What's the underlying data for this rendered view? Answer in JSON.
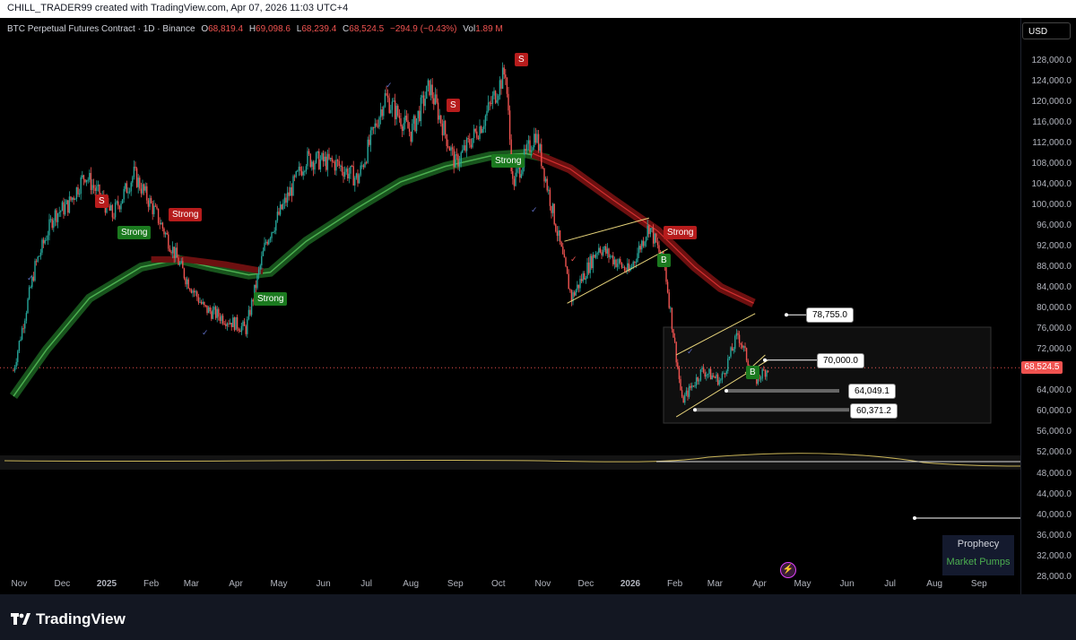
{
  "watermark": "CHILL_TRADER99 created with TradingView.com, Apr 07, 2026 11:03 UTC+4",
  "legend": {
    "symbol": "BTC Perpetual Futures Contract · 1D · Binance",
    "open_label": "O",
    "open": "68,819.4",
    "high_label": "H",
    "high": "69,098.6",
    "low_label": "L",
    "low": "68,239.4",
    "close_label": "C",
    "close": "68,524.5",
    "change": "−294.9 (−0.43%)",
    "vol_label": "Vol",
    "vol": "1.89 M"
  },
  "currency": "USD",
  "current_price": "68,524.5",
  "price_scale": [
    "128,000.0",
    "124,000.0",
    "120,000.0",
    "116,000.0",
    "112,000.0",
    "108,000.0",
    "104,000.0",
    "100,000.0",
    "96,000.0",
    "92,000.0",
    "88,000.0",
    "84,000.0",
    "80,000.0",
    "76,000.0",
    "72,000.0",
    "64,000.0",
    "60,000.0",
    "56,000.0",
    "52,000.0",
    "48,000.0",
    "44,000.0",
    "40,000.0",
    "36,000.0",
    "32,000.0",
    "28,000.0"
  ],
  "time_axis": [
    "Nov",
    "Dec",
    "2025",
    "Feb",
    "Mar",
    "Apr",
    "May",
    "Jun",
    "Jul",
    "Aug",
    "Sep",
    "Oct",
    "Nov",
    "Dec",
    "2026",
    "Feb",
    "Mar",
    "Apr",
    "May",
    "Jun",
    "Jul",
    "Aug",
    "Sep"
  ],
  "callouts": {
    "level_78755": "78,755.0",
    "level_70000": "70,000.0",
    "level_64049": "64,049.1",
    "level_60371": "60,371.2"
  },
  "signals": {
    "strong": "Strong",
    "sell": "S",
    "buy": "B"
  },
  "indicator": {
    "prophecy": "Prophecy",
    "market_pumps": "Market Pumps"
  },
  "footer": {
    "brand": "TradingView"
  },
  "colors": {
    "up": "#26a69a",
    "down": "#ef5350",
    "ribbon_green": "#1b5e20",
    "ribbon_red": "#6d1010",
    "trendline": "#e6d37a",
    "oscillator": "#c9b458"
  },
  "chart_data": {
    "type": "candlestick",
    "x_label": "date",
    "y_label": "USD",
    "ylim": [
      28000,
      130000
    ],
    "path": [
      [
        "2024-10-28",
        68000
      ],
      [
        "2024-11-12",
        88000
      ],
      [
        "2024-11-25",
        98000
      ],
      [
        "2024-12-05",
        100000
      ],
      [
        "2024-12-17",
        106000
      ],
      [
        "2025-01-05",
        98000
      ],
      [
        "2025-01-20",
        106000
      ],
      [
        "2025-02-05",
        98000
      ],
      [
        "2025-02-25",
        86000
      ],
      [
        "2025-03-10",
        80000
      ],
      [
        "2025-04-08",
        76000
      ],
      [
        "2025-04-22",
        93000
      ],
      [
        "2025-05-20",
        109000
      ],
      [
        "2025-06-10",
        108000
      ],
      [
        "2025-06-25",
        105000
      ],
      [
        "2025-07-14",
        121000
      ],
      [
        "2025-08-01",
        114000
      ],
      [
        "2025-08-14",
        123000
      ],
      [
        "2025-09-01",
        108000
      ],
      [
        "2025-09-20",
        116000
      ],
      [
        "2025-10-06",
        126000
      ],
      [
        "2025-10-11",
        104000
      ],
      [
        "2025-10-27",
        114000
      ],
      [
        "2025-11-21",
        82000
      ],
      [
        "2025-12-10",
        92000
      ],
      [
        "2025-12-31",
        87000
      ],
      [
        "2026-01-14",
        96000
      ],
      [
        "2026-01-25",
        88000
      ],
      [
        "2026-02-06",
        62000
      ],
      [
        "2026-02-20",
        68000
      ],
      [
        "2026-03-05",
        66000
      ],
      [
        "2026-03-17",
        75000
      ],
      [
        "2026-03-29",
        66000
      ],
      [
        "2026-04-07",
        68524.5
      ]
    ]
  }
}
